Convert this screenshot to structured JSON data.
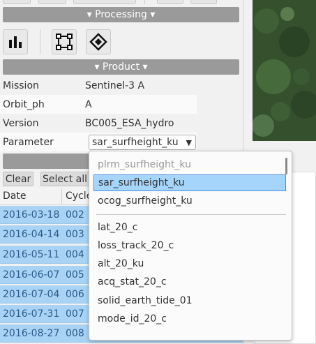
{
  "sections": {
    "processing": "▾ Processing ▾",
    "product": "▾ Product ▾"
  },
  "properties": [
    {
      "key": "Mission",
      "value": "Sentinel-3 A"
    },
    {
      "key": "Orbit_ph",
      "value": "A"
    },
    {
      "key": "Version",
      "value": "BC005_ESA_hydro"
    },
    {
      "key": "Parameter",
      "value": "sar_surfheight_ku"
    }
  ],
  "buttons": {
    "clear": "Clear",
    "select_all": "Select all"
  },
  "table": {
    "headers": [
      "Date",
      "Cycle"
    ],
    "rows": [
      [
        "2016-03-18",
        "002"
      ],
      [
        "2016-04-14",
        "003"
      ],
      [
        "2016-05-11",
        "004"
      ],
      [
        "2016-06-07",
        "005"
      ],
      [
        "2016-07-04",
        "006"
      ],
      [
        "2016-07-31",
        "007"
      ],
      [
        "2016-08-27",
        "008"
      ]
    ]
  },
  "dropdown": {
    "selected": "sar_surfheight_ku",
    "options_group1": [
      "plrm_surfheight_ku",
      "sar_surfheight_ku",
      "ocog_surfheight_ku"
    ],
    "options_group2": [
      "lat_20_c",
      "loss_track_20_c",
      "alt_20_ku",
      "acq_stat_20_c",
      "solid_earth_tide_01",
      "mode_id_20_c"
    ]
  },
  "icons": [
    "bar-chart-icon",
    "bounding-box-icon",
    "diamond-target-icon",
    "caret-down-icon"
  ]
}
